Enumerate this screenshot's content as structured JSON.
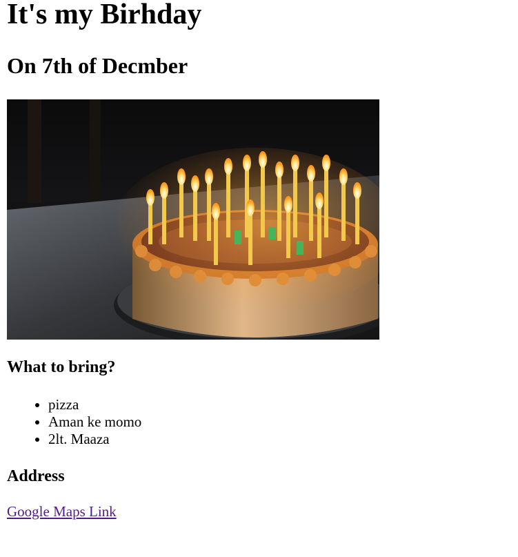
{
  "page": {
    "title": "It's my Birhday",
    "subtitle": "On 7th of Decmber"
  },
  "bring": {
    "heading": "What to bring?",
    "items": [
      "pizza",
      "Aman ke momo",
      "2lt. Maaza"
    ]
  },
  "address": {
    "heading": "Address",
    "link_text": "Google Maps Link"
  },
  "colors": {
    "visited_link": "#551a8b",
    "text": "#000000",
    "background": "#ffffff"
  }
}
